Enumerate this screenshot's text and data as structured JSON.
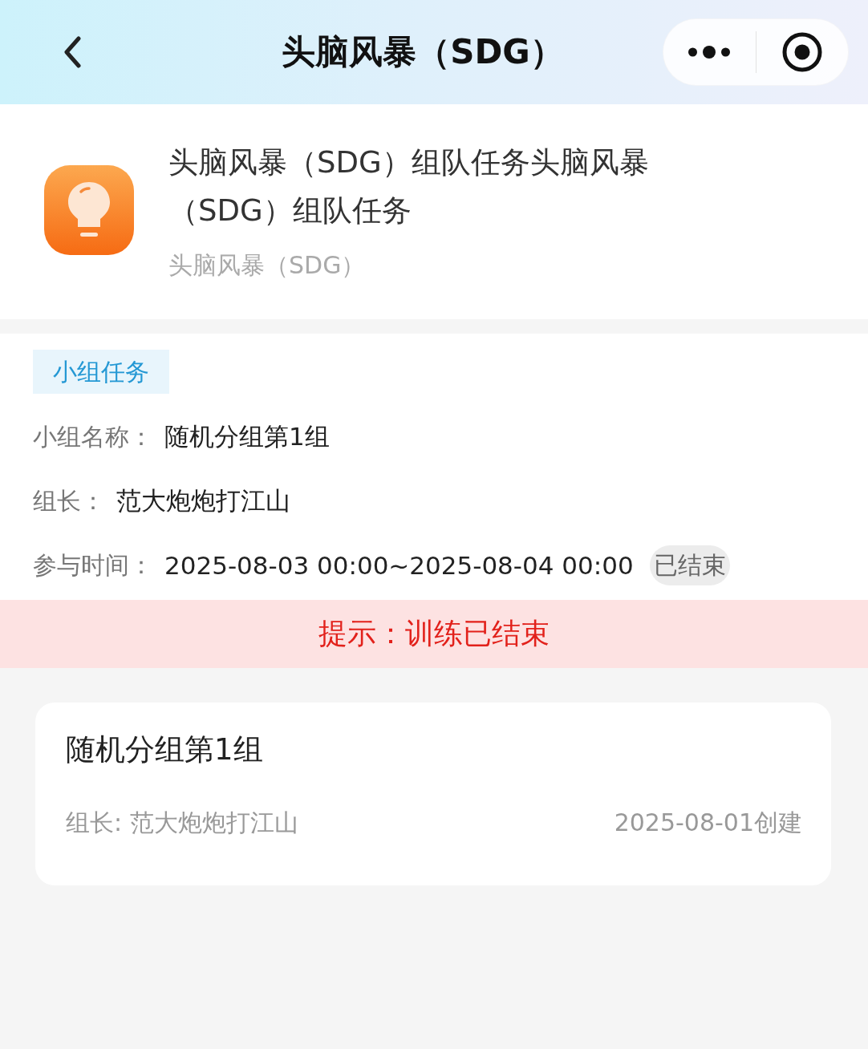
{
  "nav_bar": {
    "title": "头脑风暴（SDG）"
  },
  "task_header": {
    "title": "头脑风暴（SDG）组队任务头脑风暴（SDG）组队任务",
    "subtitle": "头脑风暴（SDG）"
  },
  "group_info": {
    "tag": "小组任务",
    "fields": [
      {
        "label": "小组名称：",
        "value": "随机分组第1组"
      },
      {
        "label": "组长：",
        "value": "范大炮炮打江山"
      },
      {
        "label": "参与时间：",
        "value": "2025-08-03 00:00~2025-08-04 00:00",
        "status": "已结束"
      }
    ]
  },
  "notice": {
    "text": "提示：训练已结束"
  },
  "groups": [
    {
      "name": "随机分组第1组",
      "leader": "组长: 范大炮炮打江山",
      "created": "2025-08-01创建"
    }
  ]
}
